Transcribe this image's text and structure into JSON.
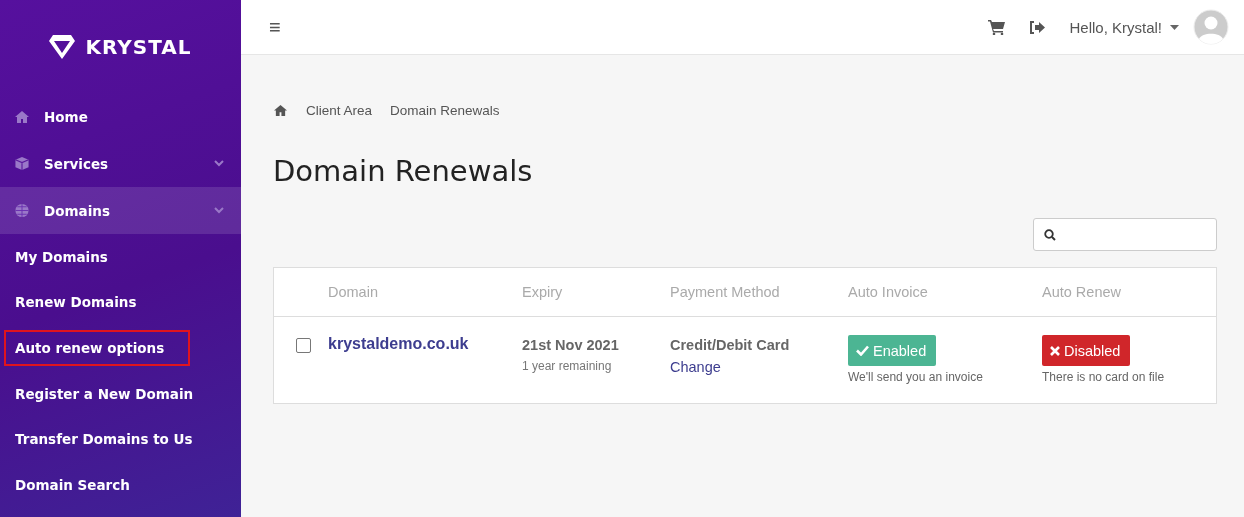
{
  "brand": {
    "name": "KRYSTAL"
  },
  "sidebar": {
    "items": [
      {
        "label": "Home",
        "kind": "home",
        "expandable": false,
        "selected": false
      },
      {
        "label": "Services",
        "kind": "product",
        "expandable": true,
        "selected": false
      },
      {
        "label": "Domains",
        "kind": "domain",
        "expandable": true,
        "selected": true
      }
    ],
    "subitems": [
      {
        "label": "My Domains",
        "highlighted": false
      },
      {
        "label": "Renew Domains",
        "highlighted": false
      },
      {
        "label": "Auto renew options",
        "highlighted": true
      },
      {
        "label": "Register a New Domain",
        "highlighted": false
      },
      {
        "label": "Transfer Domains to Us",
        "highlighted": false
      },
      {
        "label": "Domain Search",
        "highlighted": false
      }
    ]
  },
  "topbar": {
    "menu_icon": "≡",
    "greeting": "Hello, Krystal!"
  },
  "breadcrumb": [
    "Client Area",
    "Domain Renewals"
  ],
  "page_title": "Domain Renewals",
  "table": {
    "columns": [
      "Domain",
      "Expiry",
      "Payment Method",
      "Auto Invoice",
      "Auto Renew"
    ],
    "rows": [
      {
        "checked": false,
        "domain": "krystaldemo.co.uk",
        "expiry": "21st Nov 2021",
        "remaining": "1 year remaining",
        "payment": "Credit/Debit Card",
        "payment_link": "Change",
        "auto_invoice": {
          "enabled": true,
          "label": "Enabled",
          "note": "We'll send you an invoice"
        },
        "auto_renew": {
          "enabled": false,
          "label": "Disabled",
          "note": "There is no card on file"
        }
      }
    ]
  }
}
